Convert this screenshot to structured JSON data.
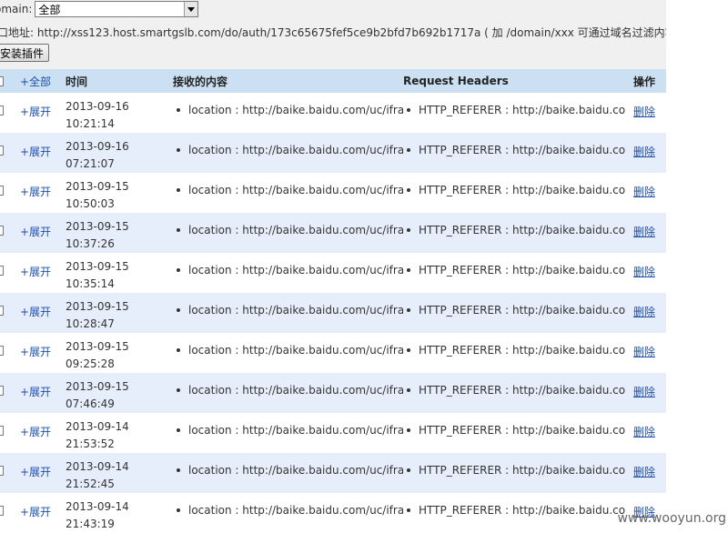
{
  "filter": {
    "label": "omain:",
    "selected": "全部"
  },
  "address": {
    "text": "口地址: http://xss123.host.smartgslb.com/do/auth/173c65675fef5ce9b2bfd7b692b1717a ( 加 /domain/xxx 可通过域名过滤内容)"
  },
  "install_button": "安装插件",
  "table": {
    "headers": {
      "expand_all": "+全部",
      "time": "时间",
      "content": "接收的内容",
      "request_headers": "Request Headers",
      "actions": "操作"
    },
    "rows": [
      {
        "expand": "+展开",
        "date": "2013-09-16",
        "time": "10:21:14",
        "content": "location : http://baike.baidu.com/uc/ifram",
        "headers": "HTTP_REFERER : http://baike.baidu.co",
        "delete": "删除"
      },
      {
        "expand": "+展开",
        "date": "2013-09-16",
        "time": "07:21:07",
        "content": "location : http://baike.baidu.com/uc/ifram",
        "headers": "HTTP_REFERER : http://baike.baidu.co",
        "delete": "删除"
      },
      {
        "expand": "+展开",
        "date": "2013-09-15",
        "time": "10:50:03",
        "content": "location : http://baike.baidu.com/uc/ifram",
        "headers": "HTTP_REFERER : http://baike.baidu.co",
        "delete": "删除"
      },
      {
        "expand": "+展开",
        "date": "2013-09-15",
        "time": "10:37:26",
        "content": "location : http://baike.baidu.com/uc/ifram",
        "headers": "HTTP_REFERER : http://baike.baidu.co",
        "delete": "删除"
      },
      {
        "expand": "+展开",
        "date": "2013-09-15",
        "time": "10:35:14",
        "content": "location : http://baike.baidu.com/uc/ifram",
        "headers": "HTTP_REFERER : http://baike.baidu.co",
        "delete": "删除"
      },
      {
        "expand": "+展开",
        "date": "2013-09-15",
        "time": "10:28:47",
        "content": "location : http://baike.baidu.com/uc/ifram",
        "headers": "HTTP_REFERER : http://baike.baidu.co",
        "delete": "删除"
      },
      {
        "expand": "+展开",
        "date": "2013-09-15",
        "time": "09:25:28",
        "content": "location : http://baike.baidu.com/uc/ifram",
        "headers": "HTTP_REFERER : http://baike.baidu.co",
        "delete": "删除"
      },
      {
        "expand": "+展开",
        "date": "2013-09-15",
        "time": "07:46:49",
        "content": "location : http://baike.baidu.com/uc/ifram",
        "headers": "HTTP_REFERER : http://baike.baidu.co",
        "delete": "删除"
      },
      {
        "expand": "+展开",
        "date": "2013-09-14",
        "time": "21:53:52",
        "content": "location : http://baike.baidu.com/uc/ifram",
        "headers": "HTTP_REFERER : http://baike.baidu.co",
        "delete": "删除"
      },
      {
        "expand": "+展开",
        "date": "2013-09-14",
        "time": "21:52:45",
        "content": "location : http://baike.baidu.com/uc/ifram",
        "headers": "HTTP_REFERER : http://baike.baidu.co",
        "delete": "删除"
      },
      {
        "expand": "+展开",
        "date": "2013-09-14",
        "time": "21:43:19",
        "content": "location : http://baike.baidu.com/uc/ifram",
        "headers": "HTTP_REFERER : http://baike.baidu.co",
        "delete": "删除"
      }
    ]
  },
  "watermark": "www.wooyun.org",
  "colors": {
    "header_bg": "#cce0f4",
    "row_alt_bg": "#e7eefb",
    "link": "#1e4fa8",
    "page_bg": "#f0f0f0"
  },
  "icons": {
    "select_arrow": "chevron-down-icon",
    "bullet": "bullet-icon"
  }
}
